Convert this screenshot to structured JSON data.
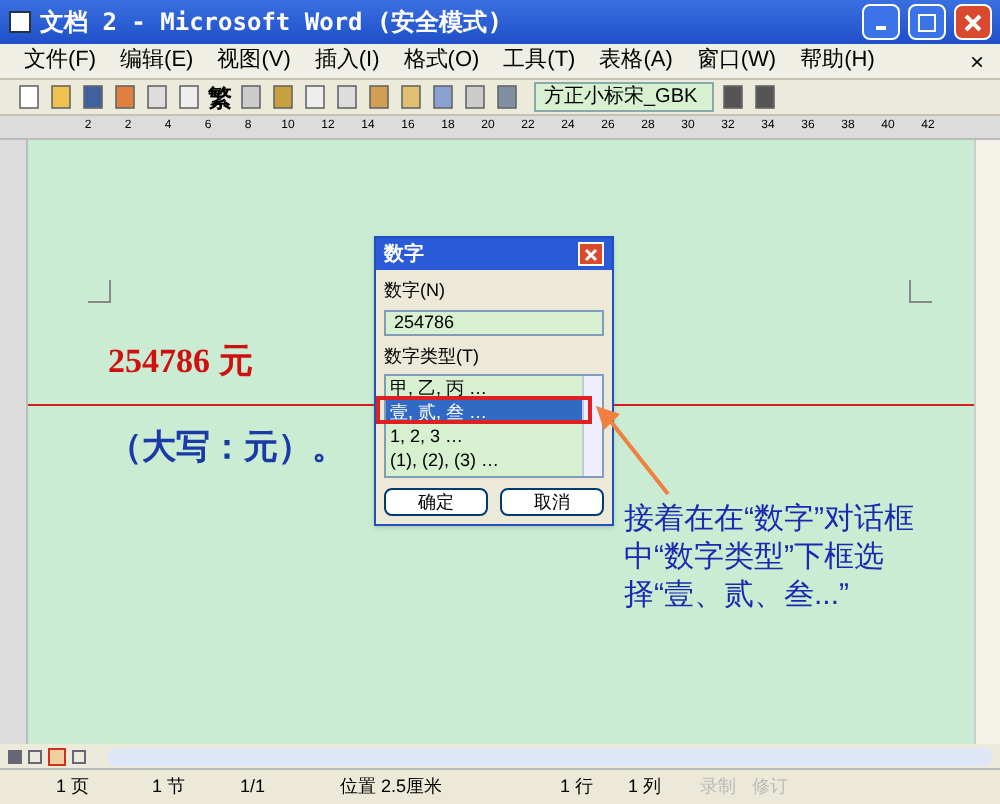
{
  "window": {
    "title": "文档 2 - Microsoft Word (安全模式)"
  },
  "menu": [
    {
      "label": "文件(F)"
    },
    {
      "label": "编辑(E)"
    },
    {
      "label": "视图(V)"
    },
    {
      "label": "插入(I)"
    },
    {
      "label": "格式(O)"
    },
    {
      "label": "工具(T)"
    },
    {
      "label": "表格(A)"
    },
    {
      "label": "窗口(W)"
    },
    {
      "label": "帮助(H)"
    }
  ],
  "menu_close": "×",
  "toolbar": {
    "trad_button": "繁",
    "font": "方正小标宋_GBK"
  },
  "ruler": [
    "2",
    "2",
    "4",
    "6",
    "8",
    "10",
    "12",
    "14",
    "16",
    "18",
    "20",
    "22",
    "24",
    "26",
    "28",
    "30",
    "32",
    "34",
    "36",
    "38",
    "40",
    "42"
  ],
  "document": {
    "amount": "254786 元",
    "uppercase": "（大写：元）。"
  },
  "dialog": {
    "title": "数字",
    "number_label": "数字(N)",
    "number_value": "254786",
    "type_label": "数字类型(T)",
    "items": [
      {
        "label": "甲, 乙, 丙 …",
        "selected": false
      },
      {
        "label": "壹, 贰, 叁 …",
        "selected": true
      },
      {
        "label": "1, 2, 3 …",
        "selected": false
      },
      {
        "label": "(1), (2), (3) …",
        "selected": false
      }
    ],
    "ok": "确定",
    "cancel": "取消"
  },
  "annotation": "接着在在“数字”对话框中“数字类型”下框选择“壹、贰、叁...”",
  "status_bar": [
    {
      "text": "1 页",
      "disabled": false
    },
    {
      "text": "1 节",
      "disabled": false
    },
    {
      "text": "1/1",
      "disabled": false
    },
    {
      "text": "位置 2.5厘米",
      "disabled": false
    },
    {
      "text": "1 行",
      "disabled": false
    },
    {
      "text": "1 列",
      "disabled": false
    },
    {
      "text": "录制",
      "disabled": true
    },
    {
      "text": "修订",
      "disabled": true
    }
  ]
}
